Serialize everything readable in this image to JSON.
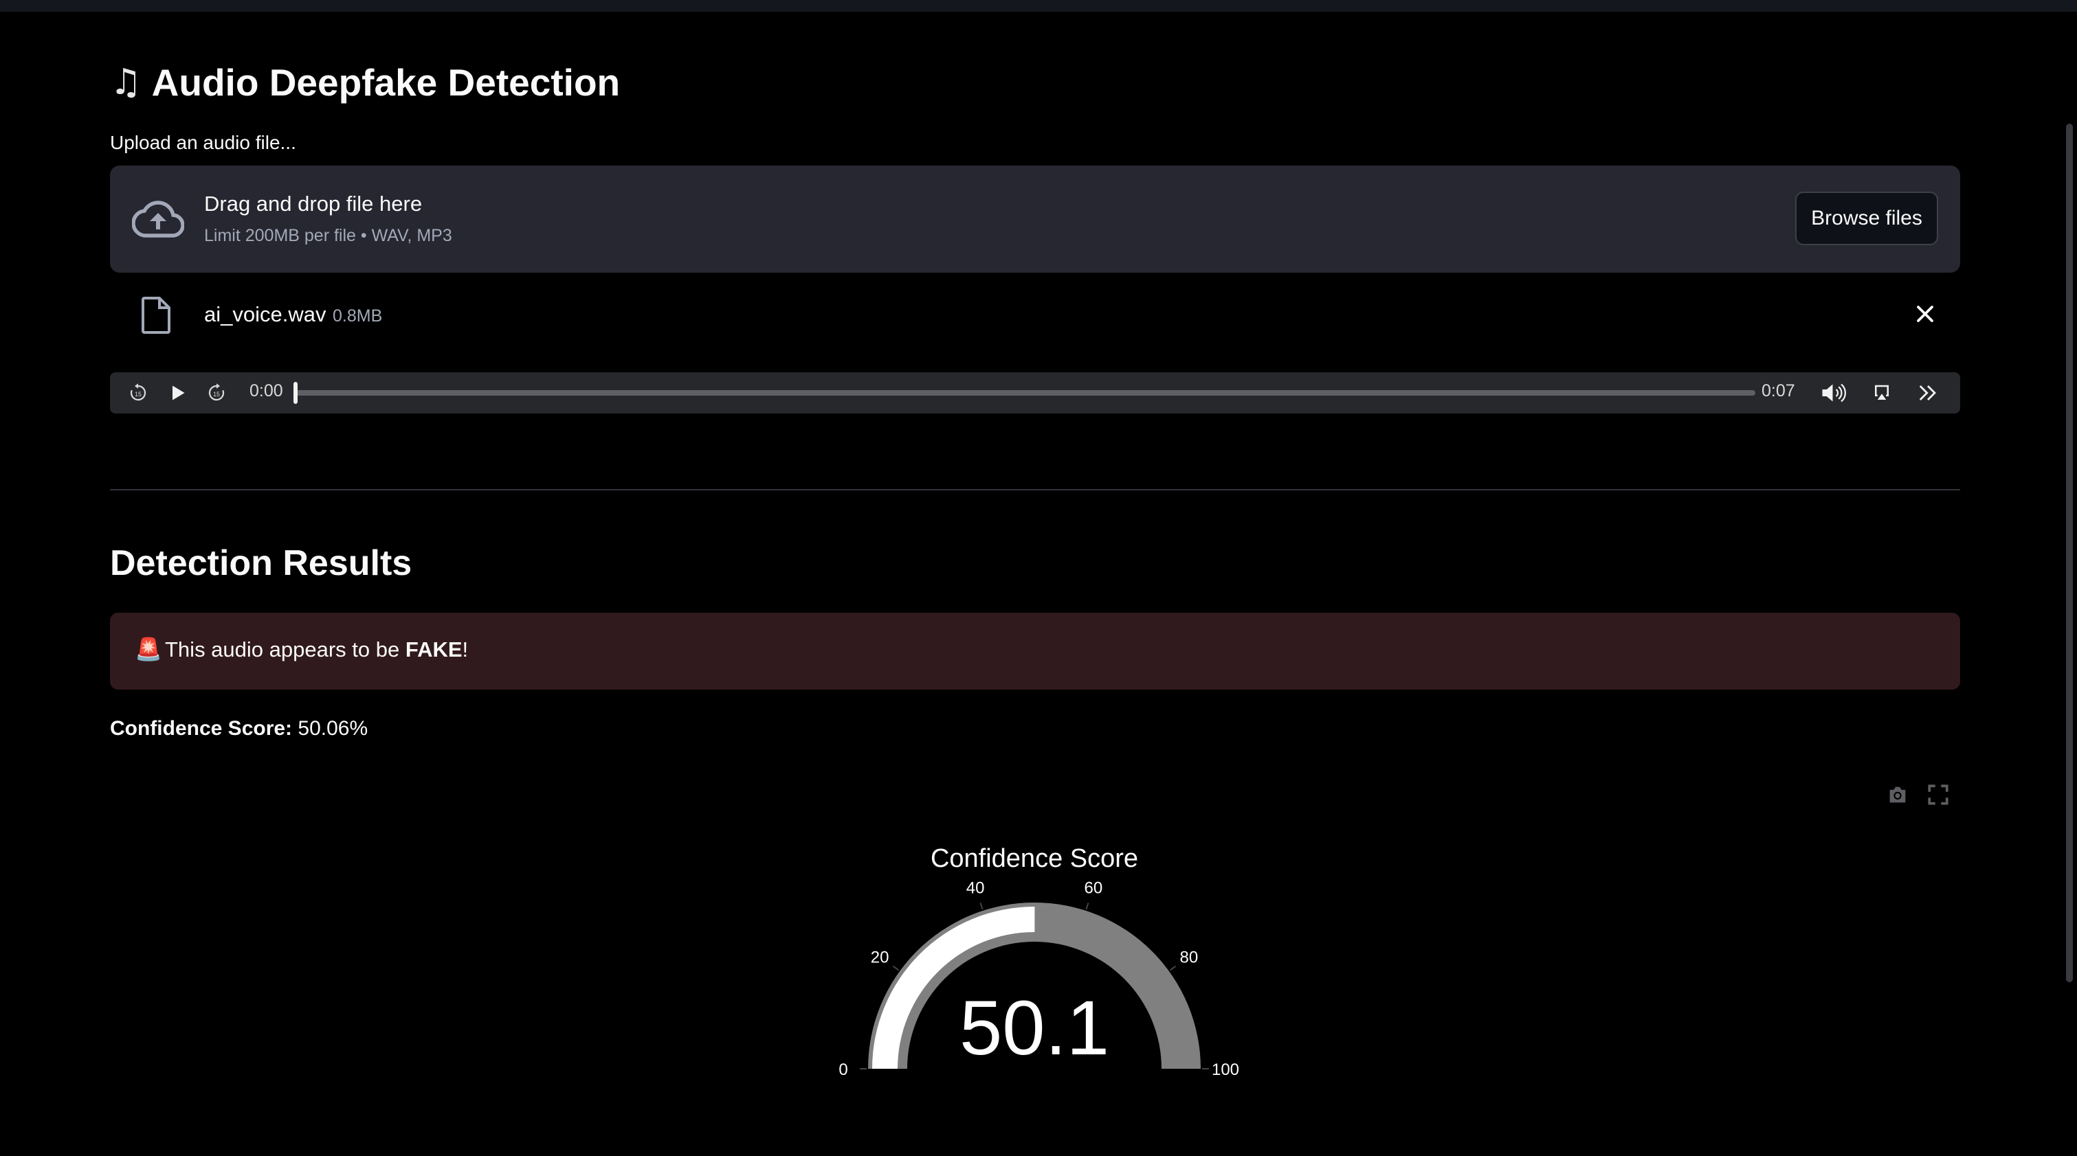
{
  "app": {
    "title_icon": "musical-note-icon",
    "title": "Audio Deepfake Detection"
  },
  "uploader": {
    "label": "Upload an audio file...",
    "drop_text": "Drag and drop file here",
    "limit_text": "Limit 200MB per file • WAV, MP3",
    "browse_label": "Browse files"
  },
  "file": {
    "name": "ai_voice.wav",
    "size": "0.8MB"
  },
  "player": {
    "current_time": "0:00",
    "duration": "0:07",
    "progress": 0
  },
  "results": {
    "heading": "Detection Results",
    "alert_prefix": "This audio appears to be ",
    "alert_verdict": "FAKE",
    "alert_suffix": "!",
    "confidence_label": "Confidence Score:",
    "confidence_value": "50.06%"
  },
  "chart_data": {
    "type": "gauge",
    "title": "Confidence Score",
    "value": 50.06,
    "display_value": "50.1",
    "range": [
      0,
      100
    ],
    "ticks": [
      0,
      20,
      40,
      60,
      80,
      100
    ],
    "tick_labels": [
      "0",
      "20",
      "40",
      "60",
      "80",
      "100"
    ],
    "bar_color": "#ffffff",
    "track_color": "#808080",
    "background": "#000000"
  },
  "colors": {
    "page_bg": "#000000",
    "dropzone_bg": "#262730",
    "alert_bg": "#311a1d",
    "text": "#fafafa",
    "muted": "#a3a8b8"
  }
}
